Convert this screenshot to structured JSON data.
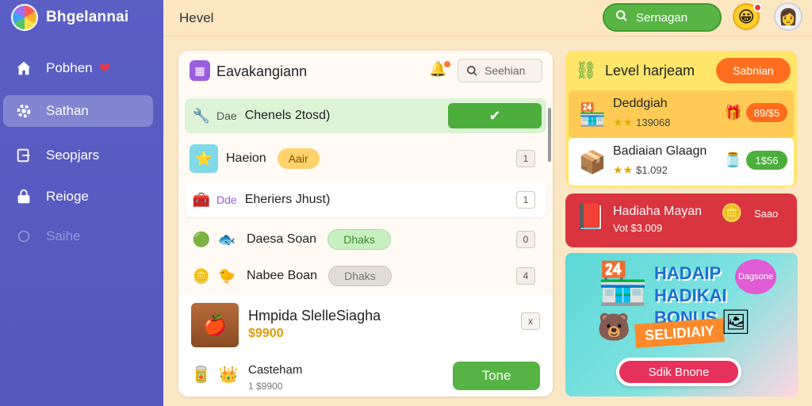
{
  "app": {
    "name": "Bhgelannai"
  },
  "sidebar": {
    "items": [
      {
        "label": "Pobhen",
        "icon": "home-icon"
      },
      {
        "label": "Sathan",
        "icon": "gear-icon"
      },
      {
        "label": "Seopjars",
        "icon": "exit-icon"
      },
      {
        "label": "Reioge",
        "icon": "lock-icon"
      },
      {
        "label": "Saihe",
        "icon": "refresh-icon"
      }
    ]
  },
  "topbar": {
    "title": "Hevel",
    "search_label": "Sernagan"
  },
  "panel": {
    "title": "Eavakangiann",
    "search_label": "Seehian",
    "rows": [
      {
        "tag": "Dae",
        "name": "Chenels 2tosd)",
        "icon": "wrench-icon"
      },
      {
        "name": "Haeion",
        "pill": "Aair",
        "count": "1"
      },
      {
        "tag": "Dde",
        "name": "Eheriers Jhust)",
        "count": "1"
      },
      {
        "name": "Daesa Soan",
        "pill": "Dhaks",
        "count": "0"
      },
      {
        "name": "Nabee Boan",
        "pill": "Dhaks",
        "count": "4"
      }
    ],
    "feature": {
      "title": "Hmpida SlelleSiagha",
      "price": "$9900",
      "close": "x",
      "sub_title": "Casteham",
      "sub_meta": "1 $9900",
      "done_label": "Tone"
    }
  },
  "levels": {
    "title": "Level harjeam",
    "button": "Sabnian",
    "items": [
      {
        "name": "Deddgiah",
        "meta": "139068",
        "price": "89/$5"
      },
      {
        "name": "Badiaian Glaagn",
        "meta": "$1.092",
        "price": "1$56"
      }
    ]
  },
  "promo_red": {
    "title": "Hadiaha Mayan",
    "meta": "Vot $3.009",
    "right": "Saao"
  },
  "bonus": {
    "title_line1": "HADAIP",
    "title_line2": "HADIKAI",
    "title_line3": "BONUS",
    "bubble": "Dagsone",
    "ribbon": "SELIDIAIY",
    "button": "Sdik Bnone"
  },
  "colors": {
    "sidebar": "#5a5fc4",
    "accent_green": "#58b544",
    "accent_orange": "#ff6f1f",
    "promo_red": "#d9343f"
  }
}
